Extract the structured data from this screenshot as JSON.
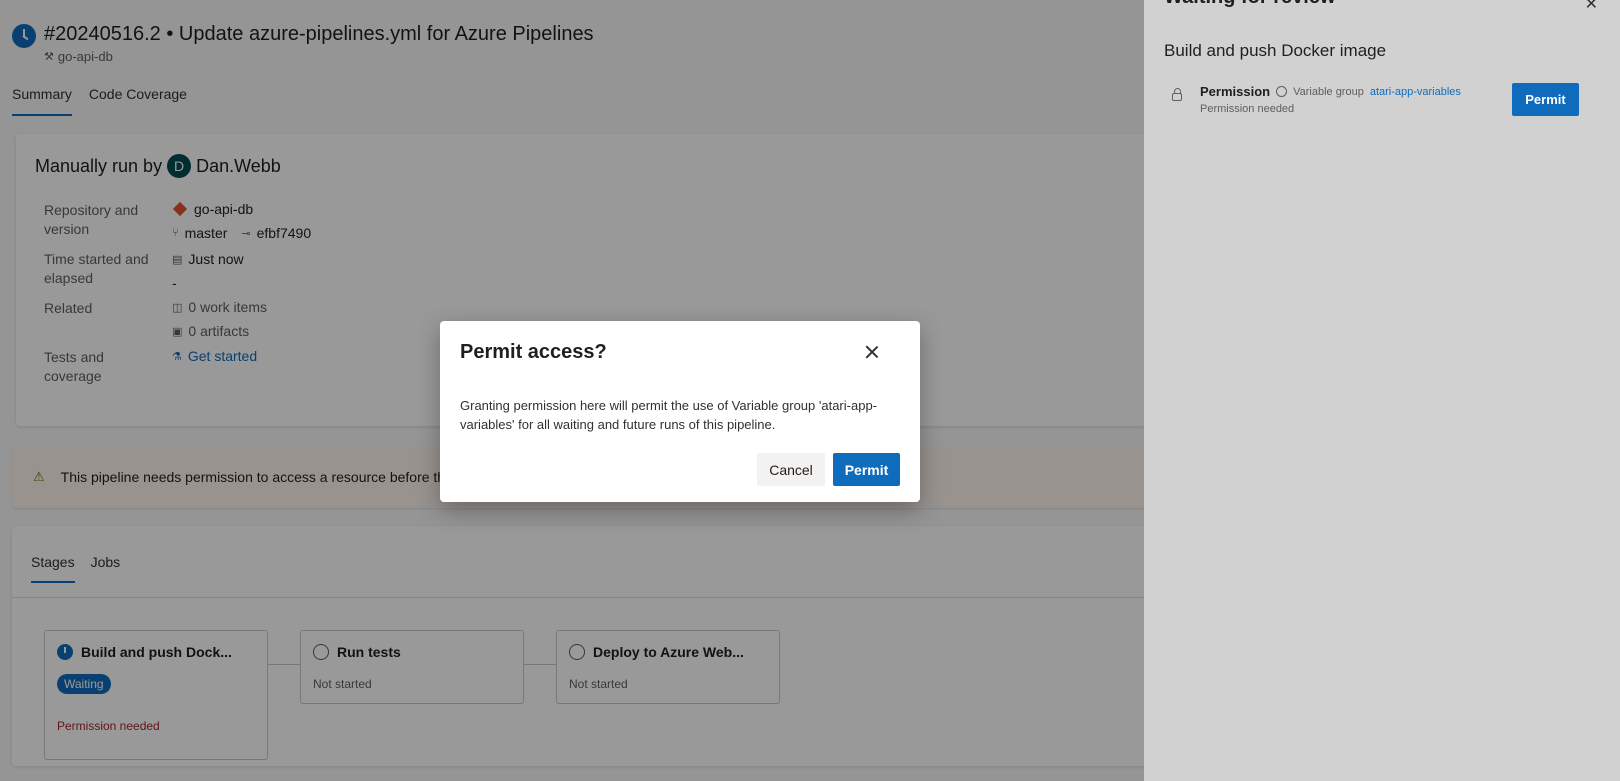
{
  "header": {
    "title": "#20240516.2 • Update azure-pipelines.yml for Azure Pipelines",
    "pipeline": "go-api-db"
  },
  "tabs": [
    {
      "label": "Summary",
      "active": true
    },
    {
      "label": "Code Coverage",
      "active": false
    }
  ],
  "summary": {
    "run_by_prefix": "Manually run by",
    "avatar_initial": "D",
    "user": "Dan.Webb",
    "repo_label": "Repository and version",
    "repo": "go-api-db",
    "branch": "master",
    "commit": "efbf7490",
    "time_label": "Time started and elapsed",
    "time": "Just now",
    "elapsed": "-",
    "related_label": "Related",
    "work_items": "0 work items",
    "artifacts": "0 artifacts",
    "tests_label": "Tests and coverage",
    "tests_link": "Get started"
  },
  "warning": {
    "text": "This pipeline needs permission to access a resource before th"
  },
  "stages_section": {
    "tabs": [
      {
        "label": "Stages",
        "active": true
      },
      {
        "label": "Jobs",
        "active": false
      }
    ],
    "stages": [
      {
        "name": "Build and push Dock...",
        "badge": "Waiting",
        "error": "Permission needed"
      },
      {
        "name": "Run tests",
        "status": "Not started"
      },
      {
        "name": "Deploy to Azure Web...",
        "status": "Not started"
      }
    ]
  },
  "panel": {
    "title": "Waiting for review",
    "section": "Build and push Docker image",
    "permission_label": "Permission",
    "resource_type": "Variable group",
    "resource_name": "atari-app-variables",
    "permission_status": "Permission needed",
    "permit_label": "Permit"
  },
  "dialog": {
    "title": "Permit access?",
    "body": "Granting permission here will permit the use of Variable group 'atari-app-variables' for all waiting and future runs of this pipeline.",
    "cancel_label": "Cancel",
    "permit_label": "Permit"
  },
  "colors": {
    "accent": "#0f6cbd",
    "error": "#a4262c",
    "overlay": "rgba(0,0,0,0.4)"
  }
}
